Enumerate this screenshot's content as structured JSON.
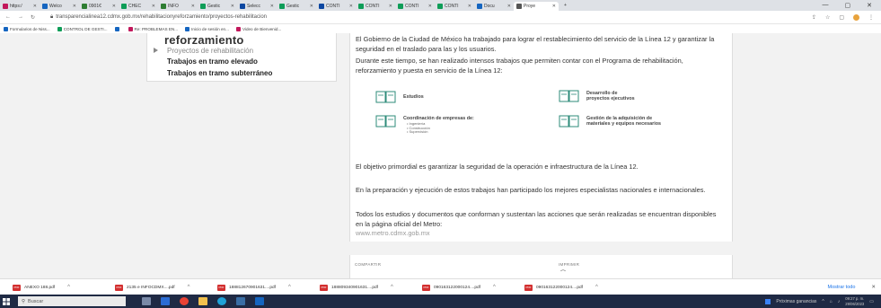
{
  "browser": {
    "tabs": [
      {
        "label": "https:/",
        "color": "#c2185b"
      },
      {
        "label": "Welco",
        "color": "#1565c0"
      },
      {
        "label": "0901€",
        "color": "#2e7d32"
      },
      {
        "label": "CHEC",
        "color": "#0f9d58"
      },
      {
        "label": "INFO",
        "color": "#2e7d32"
      },
      {
        "label": "Gestic",
        "color": "#0f9d58"
      },
      {
        "label": "Selecc",
        "color": "#0d47a1"
      },
      {
        "label": "Gestic",
        "color": "#0f9d58"
      },
      {
        "label": "CONTI",
        "color": "#0d47a1"
      },
      {
        "label": "CONTI",
        "color": "#0f9d58"
      },
      {
        "label": "CONTI",
        "color": "#0f9d58"
      },
      {
        "label": "CONTI",
        "color": "#0f9d58"
      },
      {
        "label": "Docu",
        "color": "#1565c0"
      },
      {
        "label": "Proye",
        "color": "#555555",
        "active": true
      }
    ],
    "url": "transparencialinea12.cdmx.gob.mx/rehabilitacionyreforzamiento/proyectos-rehabilitacion",
    "bookmarks": [
      {
        "label": "Formularios de Niss...",
        "color": "#1565c0"
      },
      {
        "label": "CONTROL DE GESTI...",
        "color": "#0f9d58"
      },
      {
        "label": "",
        "color": "#1565c0"
      },
      {
        "label": "Re: PROBLEMAS EN...",
        "color": "#c2185b"
      },
      {
        "label": "Inicio de sesión en...",
        "color": "#1565c0"
      },
      {
        "label": "Video de Bienvenid...",
        "color": "#c2185b"
      }
    ]
  },
  "sidebar": {
    "title": "reforzamiento",
    "items": [
      "Proyectos de rehabilitación",
      "Trabajos en tramo elevado",
      "Trabajos en tramo subterráneo"
    ]
  },
  "content": {
    "p1": "El Gobierno de la Ciudad de México ha trabajado para lograr el restablecimiento del servicio de la Línea 12 y garantizar la seguridad en el traslado para las y los usuarios.",
    "p2": "Durante este tiempo, se han realizado intensos trabajos que permiten contar con el Programa de rehabilitación, reforzamiento y puesta en servicio de la Línea 12:",
    "cards": {
      "estudios": "Estudios",
      "desarrollo_1": "Desarrollo de",
      "desarrollo_2": "proyectos ejecutivos",
      "coordinacion": "Coordinación de empresas de:",
      "coord_sub1": "• Ingeniería",
      "coord_sub2": "• Construcción",
      "coord_sub3": "• Supervisión",
      "gestion_1": "Gestión de la adquisición de",
      "gestion_2": "materiales y equipos necesarios"
    },
    "p3": "El objetivo primordial es garantizar la seguridad de la operación e infraestructura de la Línea 12.",
    "p4": "En la preparación y ejecución de estos trabajos han participado los mejores especialistas nacionales e internacionales.",
    "p5": "Todos los estudios y documentos que conforman y sustentan las acciones que serán realizadas se encuentran disponibles en la página oficial del Metro:",
    "link": "www.metro.cdmx.gob.mx"
  },
  "share": {
    "compartir": "COMPARTIR",
    "imprimir": "IMPRIMIR"
  },
  "downloads": {
    "items": [
      "ANEXO 188.pdf",
      "2135 e INFOCDMX....pdf",
      "188812670901631....pdf",
      "188809340901631....pdf",
      "090163122000124....pdf",
      "090163122000124....pdf"
    ],
    "show_all": "Mostrar todo"
  },
  "taskbar": {
    "search_placeholder": "Buscar",
    "news": "Próximas ganancias",
    "time": "09:27 p. m.",
    "date": "29/06/2023"
  }
}
